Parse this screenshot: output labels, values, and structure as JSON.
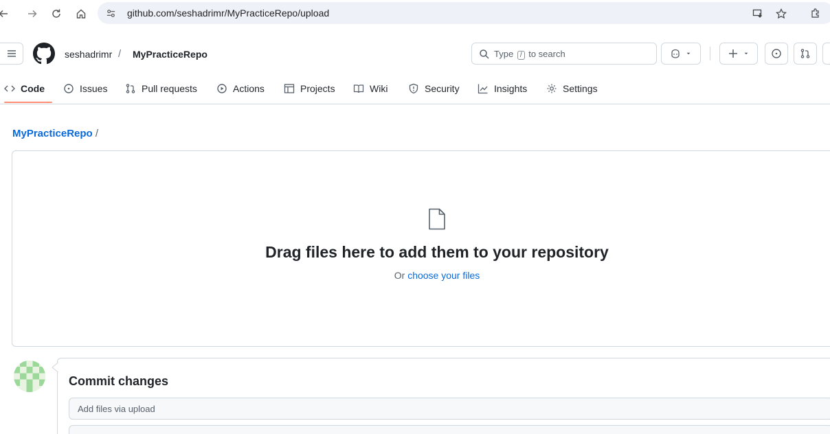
{
  "browser": {
    "url": "github.com/seshadrimr/MyPracticeRepo/upload"
  },
  "header": {
    "owner": "seshadrimr",
    "separator": "/",
    "repo": "MyPracticeRepo",
    "search": {
      "prefix": "Type",
      "key": "/",
      "suffix": "to search"
    }
  },
  "tabs": [
    {
      "label": "Code",
      "icon": "code-icon",
      "active": true
    },
    {
      "label": "Issues",
      "icon": "issue-icon"
    },
    {
      "label": "Pull requests",
      "icon": "pull-request-icon"
    },
    {
      "label": "Actions",
      "icon": "play-icon"
    },
    {
      "label": "Projects",
      "icon": "table-icon"
    },
    {
      "label": "Wiki",
      "icon": "book-icon"
    },
    {
      "label": "Security",
      "icon": "shield-icon"
    },
    {
      "label": "Insights",
      "icon": "graph-icon"
    },
    {
      "label": "Settings",
      "icon": "gear-icon"
    }
  ],
  "breadcrumb": {
    "repo": "MyPracticeRepo",
    "sep": " /"
  },
  "dropzone": {
    "title": "Drag files here to add them to your repository",
    "or": "Or ",
    "link": "choose your files"
  },
  "commit": {
    "title": "Commit changes",
    "placeholder": "Add files via upload"
  },
  "colors": {
    "link": "#0969da",
    "active_tab_underline": "#fd8c73",
    "border": "#d0d7de"
  }
}
